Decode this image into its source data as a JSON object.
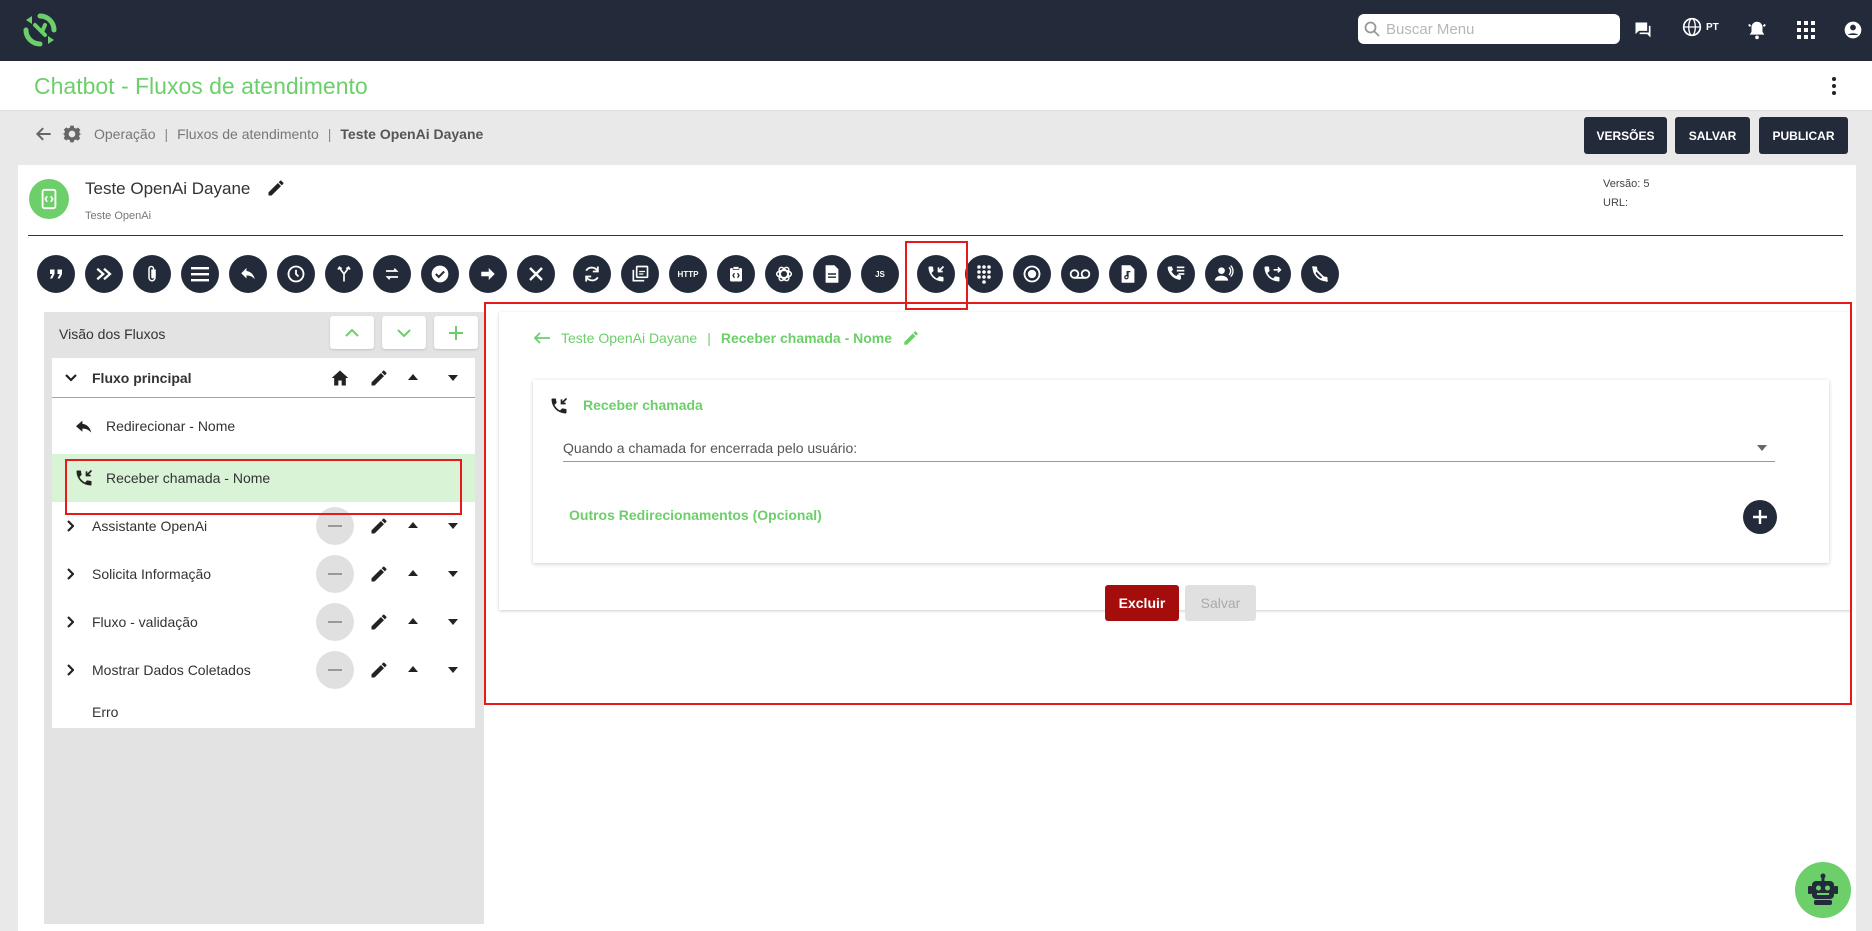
{
  "topbar": {
    "search_placeholder": "Buscar Menu",
    "lang_code": "PT"
  },
  "title_bar": {
    "title": "Chatbot - Fluxos de atendimento"
  },
  "breadcrumb": {
    "items": [
      "Operação",
      "Fluxos de atendimento"
    ],
    "current": "Teste OpenAi Dayane",
    "sep": "|"
  },
  "actions": {
    "versions": "VERSÕES",
    "save": "SALVAR",
    "publish": "PUBLICAR"
  },
  "flow": {
    "name": "Teste OpenAi Dayane",
    "subtitle": "Teste OpenAi",
    "version": "Versão: 5",
    "url": "URL:"
  },
  "toolbar": {
    "http_label": "HTTP",
    "js_label": "JS"
  },
  "left_panel": {
    "title": "Visão dos Fluxos",
    "main_flow": "Fluxo principal",
    "children": [
      "Redirecionar - Nome",
      "Receber chamada - Nome"
    ],
    "flows": [
      "Assistante OpenAi",
      "Solicita Informação",
      "Fluxo - validação",
      "Mostrar Dados Coletados"
    ],
    "error": "Erro"
  },
  "editor": {
    "crumb_parent": "Teste OpenAi Dayane",
    "crumb_sep": "|",
    "crumb_current": "Receber chamada - Nome",
    "card_title": "Receber chamada",
    "select_label": "Quando a chamada for encerrada pelo usuário:",
    "other_redirects": "Outros Redirecionamentos (Opcional)",
    "delete_label": "Excluir",
    "save_label": "Salvar"
  },
  "colors": {
    "navy": "#232b3a",
    "green": "#6ccf6a",
    "danger": "#a50d0d",
    "highlight": "#e41b1b",
    "selected_row": "#d9f3d7"
  }
}
